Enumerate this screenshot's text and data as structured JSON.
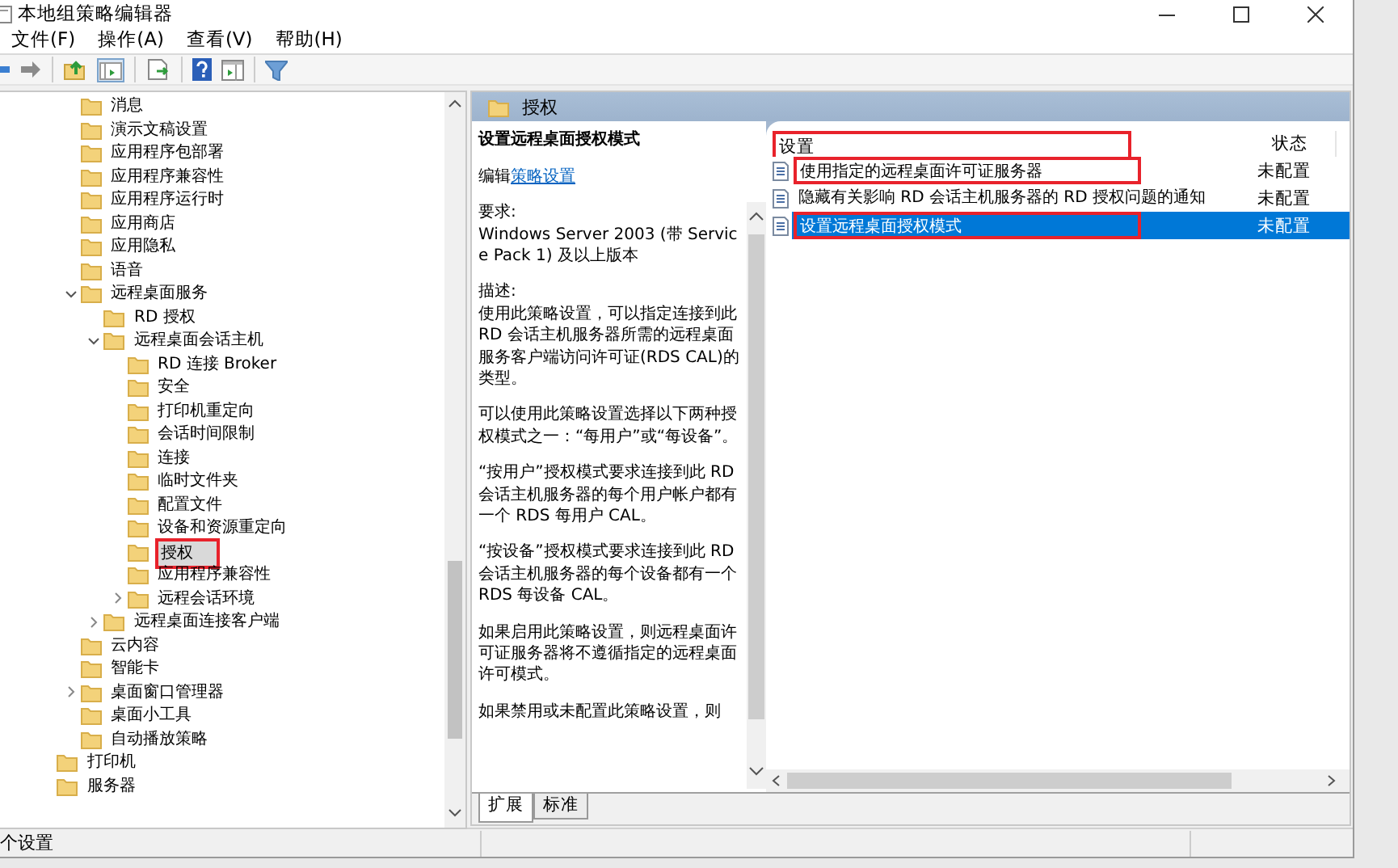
{
  "window": {
    "title": "本地组策略编辑器"
  },
  "menu": [
    {
      "label": "文件(F)"
    },
    {
      "label": "操作(A)"
    },
    {
      "label": "查看(V)"
    },
    {
      "label": "帮助(H)"
    }
  ],
  "tree": {
    "items": [
      {
        "children": [
          {
            "label": "消息",
            "selected": false,
            "highlighted": false
          },
          {
            "label": "演示文稿设置",
            "selected": false,
            "highlighted": false
          },
          {
            "label": "应用程序包部署",
            "selected": false,
            "highlighted": false
          },
          {
            "label": "应用程序兼容性",
            "selected": false,
            "highlighted": false
          },
          {
            "label": "应用程序运行时",
            "selected": false,
            "highlighted": false
          },
          {
            "label": "应用商店",
            "selected": false,
            "highlighted": false
          },
          {
            "label": "应用隐私",
            "selected": false,
            "highlighted": false
          },
          {
            "label": "语音",
            "selected": false,
            "highlighted": false
          },
          {
            "label": "远程桌面服务",
            "selected": false,
            "highlighted": false,
            "expanded": true,
            "children": [
              {
                "label": "RD 授权",
                "selected": false,
                "highlighted": false
              },
              {
                "label": "远程桌面会话主机",
                "selected": false,
                "highlighted": false,
                "expanded": true,
                "children": [
                  {
                    "label": "RD 连接 Broker",
                    "selected": false,
                    "highlighted": false
                  },
                  {
                    "label": "安全",
                    "selected": false,
                    "highlighted": false
                  },
                  {
                    "label": "打印机重定向",
                    "selected": false,
                    "highlighted": false
                  },
                  {
                    "label": "会话时间限制",
                    "selected": false,
                    "highlighted": false
                  },
                  {
                    "label": "连接",
                    "selected": false,
                    "highlighted": false
                  },
                  {
                    "label": "临时文件夹",
                    "selected": false,
                    "highlighted": false
                  },
                  {
                    "label": "配置文件",
                    "selected": false,
                    "highlighted": false
                  },
                  {
                    "label": "设备和资源重定向",
                    "selected": false,
                    "highlighted": false
                  },
                  {
                    "label": "授权",
                    "selected": true,
                    "highlighted": true
                  },
                  {
                    "label": "应用程序兼容性",
                    "selected": false,
                    "highlighted": false
                  },
                  {
                    "label": "远程会话环境",
                    "selected": false,
                    "highlighted": false,
                    "expanded": false
                  }
                ]
              },
              {
                "label": "远程桌面连接客户端",
                "selected": false,
                "highlighted": false,
                "expanded": false
              }
            ]
          },
          {
            "label": "云内容",
            "selected": false,
            "highlighted": false
          },
          {
            "label": "智能卡",
            "selected": false,
            "highlighted": false
          },
          {
            "label": "桌面窗口管理器",
            "selected": false,
            "highlighted": false,
            "expanded": false
          },
          {
            "label": "桌面小工具",
            "selected": false,
            "highlighted": false
          },
          {
            "label": "自动播放策略",
            "selected": false,
            "highlighted": false
          }
        ]
      },
      {
        "label": "打印机",
        "selected": false,
        "highlighted": false
      },
      {
        "label": "服务器",
        "selected": false,
        "highlighted": false
      }
    ]
  },
  "details": {
    "header": "授权",
    "title": "设置远程桌面授权模式",
    "edit_prefix": "编辑",
    "edit_link": "策略设置",
    "paragraphs": [
      "要求:\nWindows Server 2003 (带 Service Pack 1) 及以上版本",
      "描述:\n使用此策略设置，可以指定连接到此 RD 会话主机服务器所需的远程桌面服务客户端访问许可证(RDS CAL)的类型。",
      "可以使用此策略设置选择以下两种授权模式之一：“每用户”或“每设备”。",
      "“按用户”授权模式要求连接到此 RD 会话主机服务器的每个用户帐户都有一个 RDS 每用户 CAL。",
      "“按设备”授权模式要求连接到此 RD 会话主机服务器的每个设备都有一个 RDS 每设备 CAL。",
      "如果启用此策略设置，则远程桌面许可证服务器将不遵循指定的远程桌面许可模式。",
      "如果禁用或未配置此策略设置，则"
    ]
  },
  "list": {
    "columns": [
      {
        "label": "设置",
        "highlighted": true
      },
      {
        "label": "状态",
        "highlighted": false
      }
    ],
    "rows": [
      {
        "name": "使用指定的远程桌面许可证服务器",
        "status": "未配置",
        "selected": false,
        "highlighted": true
      },
      {
        "name": "隐藏有关影响 RD 会话主机服务器的 RD 授权问题的通知",
        "status": "未配置",
        "selected": false,
        "highlighted": false
      },
      {
        "name": "设置远程桌面授权模式",
        "status": "未配置",
        "selected": true,
        "highlighted": true
      }
    ]
  },
  "tabs": [
    {
      "label": "扩展",
      "selected": true
    },
    {
      "label": "标准",
      "selected": false
    }
  ],
  "status_bar": {
    "text": "个设置"
  }
}
